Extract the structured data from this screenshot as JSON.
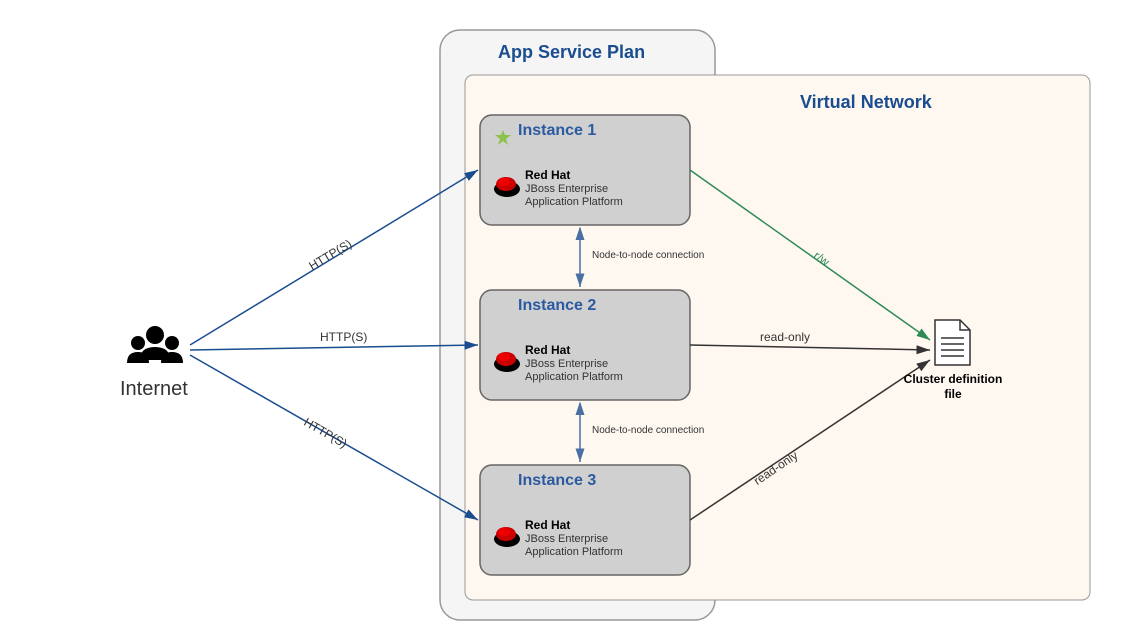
{
  "titles": {
    "appServicePlan": "App Service Plan",
    "virtualNetwork": "Virtual Network"
  },
  "internet": {
    "label": "Internet"
  },
  "instances": [
    {
      "title": "Instance 1",
      "vendor": "Red Hat",
      "product1": "JBoss Enterprise",
      "product2": "Application Platform",
      "starred": true
    },
    {
      "title": "Instance 2",
      "vendor": "Red Hat",
      "product1": "JBoss Enterprise",
      "product2": "Application Platform",
      "starred": false
    },
    {
      "title": "Instance 3",
      "vendor": "Red Hat",
      "product1": "JBoss Enterprise",
      "product2": "Application Platform",
      "starred": false
    }
  ],
  "connections": {
    "http1": "HTTP(S)",
    "http2": "HTTP(S)",
    "http3": "HTTP(S)",
    "nodeToNode1": "Node-to-node connection",
    "nodeToNode2": "Node-to-node connection",
    "rw": "r/w",
    "readonly1": "read-only",
    "readonly2": "read-only"
  },
  "file": {
    "label1": "Cluster definition",
    "label2": "file"
  }
}
